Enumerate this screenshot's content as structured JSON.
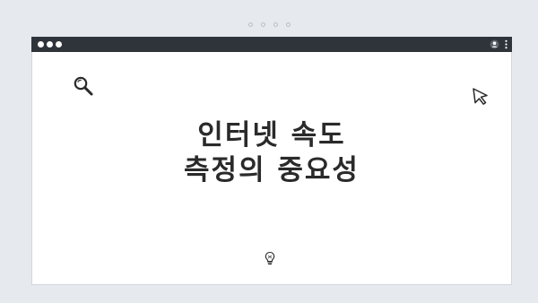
{
  "slide": {
    "title_line_1": "인터넷 속도",
    "title_line_2": "측정의 중요성"
  },
  "icons": {
    "titlebar_left": "window-controls",
    "titlebar_right_1": "account-icon",
    "titlebar_right_2": "more-menu-icon",
    "top_left": "search-icon",
    "top_right": "cursor-icon",
    "bottom_center": "lightbulb-icon"
  },
  "colors": {
    "background": "#e6e9ee",
    "titlebar": "#2f343a",
    "window": "#ffffff",
    "text": "#2a2a2a"
  }
}
